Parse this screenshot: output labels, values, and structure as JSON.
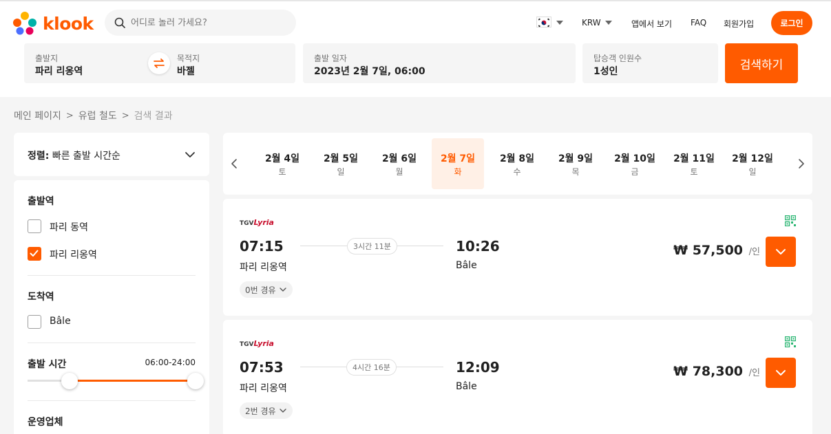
{
  "header": {
    "logo_text": "klook",
    "search_placeholder": "어디로 놀러 가세요?",
    "currency": "KRW",
    "app_link": "앱에서 보기",
    "faq": "FAQ",
    "signup": "회원가입",
    "login": "로그인",
    "brand_color": "#ff5b00"
  },
  "search": {
    "from_label": "출발지",
    "from_value": "파리 리옹역",
    "to_label": "목적지",
    "to_value": "바젤",
    "date_label": "출발 일자",
    "date_value": "2023년 2월 7일, 06:00",
    "pax_label": "탑승객 인원수",
    "pax_value": "1성인",
    "button": "검색하기"
  },
  "breadcrumb": {
    "home": "메인 페이지",
    "rail": "유럽 철도",
    "current": "검색 결과"
  },
  "sort": {
    "prefix": "정렬:",
    "value": "빠른 출발 시간순"
  },
  "filters": {
    "departure_title": "출발역",
    "departure_options": [
      {
        "label": "파리 동역",
        "checked": false
      },
      {
        "label": "파리 리옹역",
        "checked": true
      }
    ],
    "arrival_title": "도착역",
    "arrival_options": [
      {
        "label": "Bâle",
        "checked": false
      }
    ],
    "time_title": "출발 시간",
    "time_range": "06:00-24:00",
    "operator_title": "운영업체"
  },
  "dates": [
    {
      "date": "2월 4일",
      "weekday": "토",
      "active": false
    },
    {
      "date": "2월 5일",
      "weekday": "일",
      "active": false
    },
    {
      "date": "2월 6일",
      "weekday": "월",
      "active": false
    },
    {
      "date": "2월 7일",
      "weekday": "화",
      "active": true
    },
    {
      "date": "2월 8일",
      "weekday": "수",
      "active": false
    },
    {
      "date": "2월 9일",
      "weekday": "목",
      "active": false
    },
    {
      "date": "2월 10일",
      "weekday": "금",
      "active": false
    },
    {
      "date": "2월 11일",
      "weekday": "토",
      "active": false
    },
    {
      "date": "2월 12일",
      "weekday": "일",
      "active": false
    }
  ],
  "results": [
    {
      "operator_prefix": "TGV",
      "operator_name": "Lyria",
      "dep_time": "07:15",
      "dep_station": "파리 리옹역",
      "duration": "3시간 11분",
      "arr_time": "10:26",
      "arr_station": "Bâle",
      "stops": "0번 경유",
      "price": "₩ 57,500",
      "per": "/인"
    },
    {
      "operator_prefix": "TGV",
      "operator_name": "Lyria",
      "dep_time": "07:53",
      "dep_station": "파리 리옹역",
      "duration": "4시간 16분",
      "arr_time": "12:09",
      "arr_station": "Bâle",
      "stops": "2번 경유",
      "price": "₩ 78,300",
      "per": "/인"
    }
  ]
}
